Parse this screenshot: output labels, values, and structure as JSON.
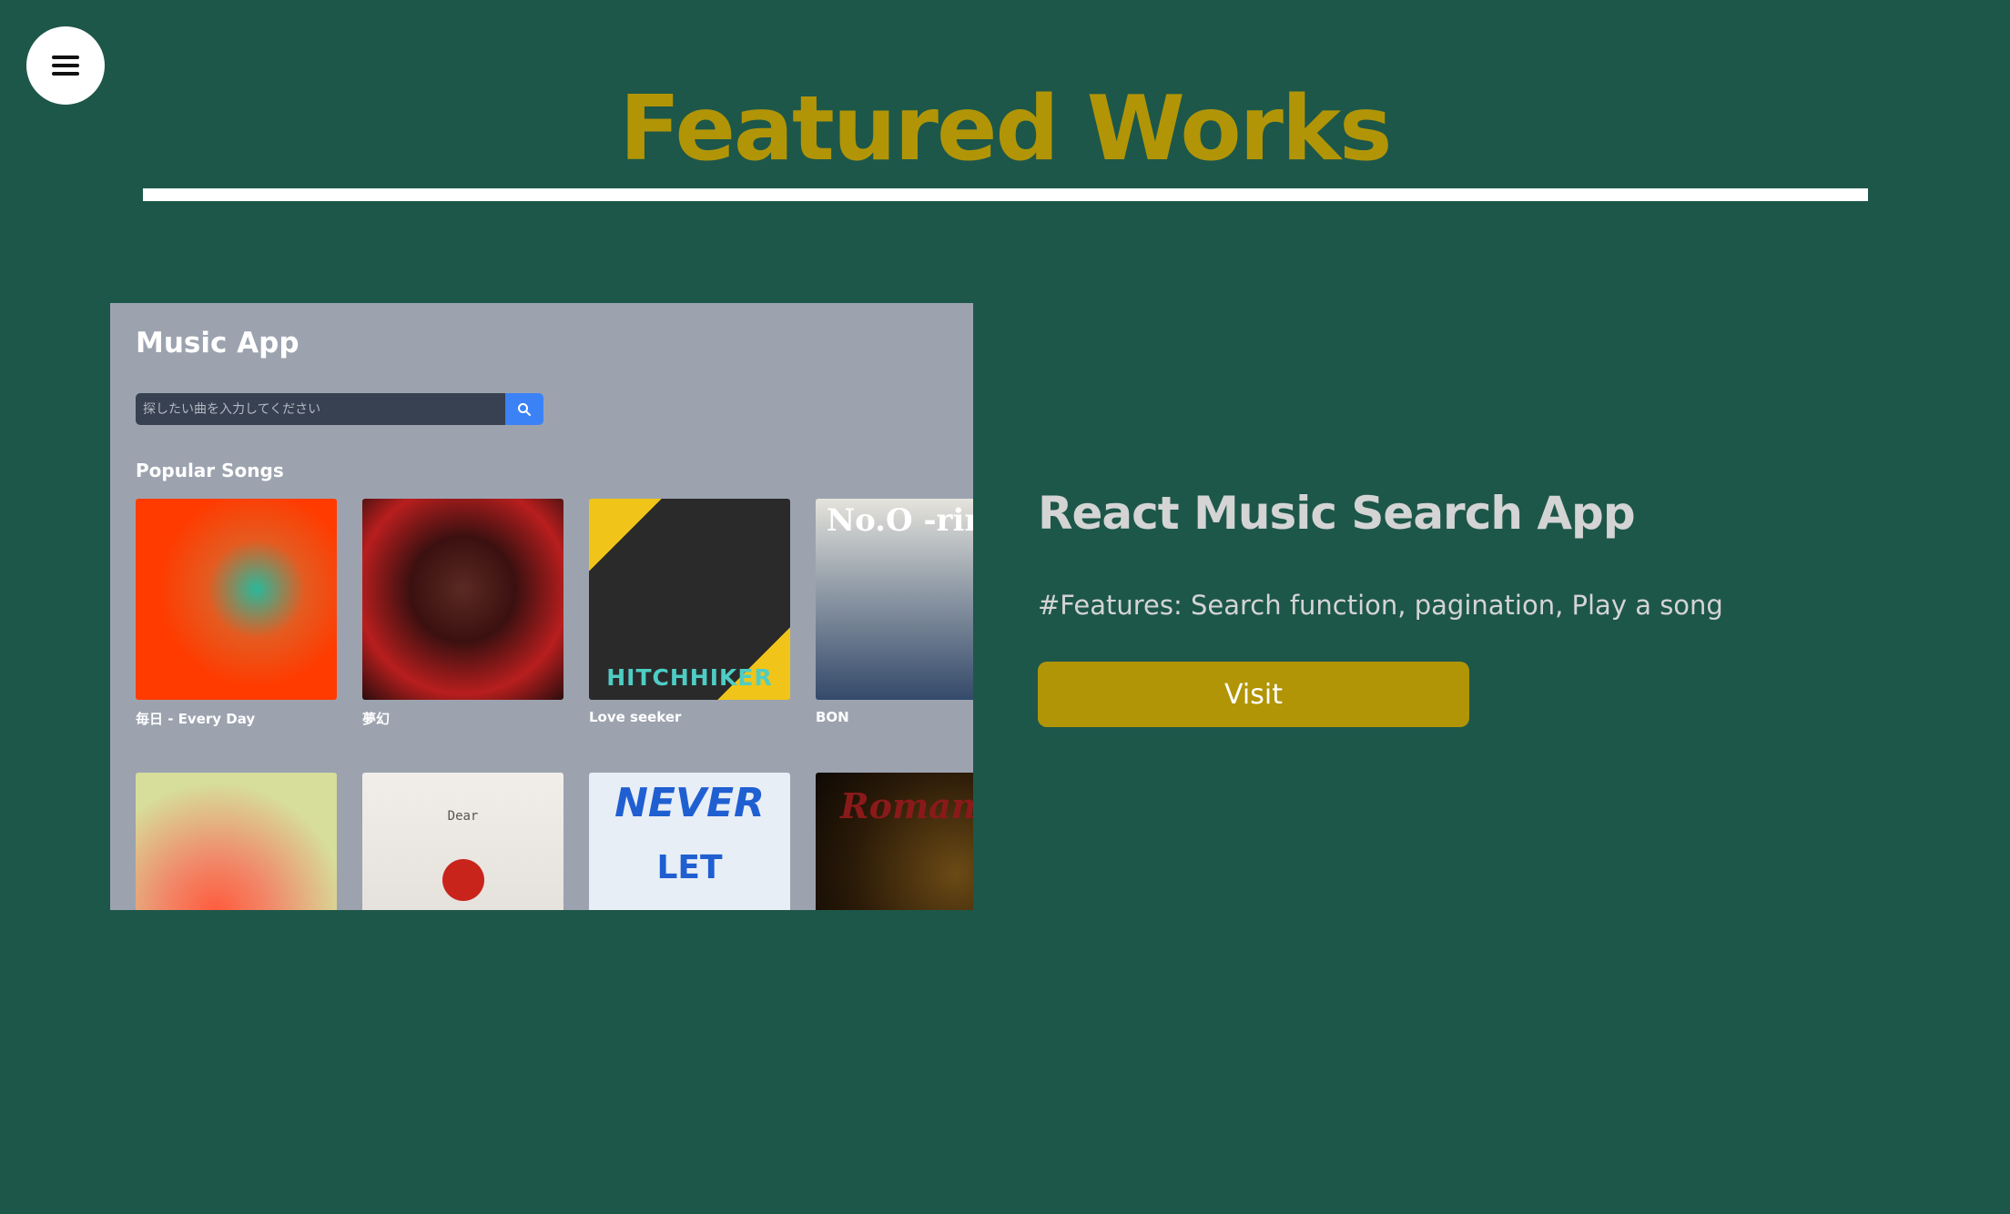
{
  "header": {
    "menu_icon": "hamburger-menu-icon",
    "title": "Featured Works"
  },
  "preview": {
    "app_title": "Music App",
    "search": {
      "placeholder": "探したい曲を入力してください",
      "button_icon": "search-icon"
    },
    "section_title": "Popular Songs",
    "songs": [
      {
        "title": "毎日 - Every Day"
      },
      {
        "title": "夢幻"
      },
      {
        "title": "Love seeker",
        "cover_text": "HITCHHIKER"
      },
      {
        "title": "BON",
        "cover_text": "No.O -rin"
      },
      {
        "title": ""
      },
      {
        "title": "",
        "cover_text": "Dear"
      },
      {
        "title": "",
        "cover_text": "NEVER",
        "cover_text_2": "LET"
      },
      {
        "title": "",
        "cover_text": "Romant"
      }
    ]
  },
  "project": {
    "title": "React Music Search App",
    "features": "#Features: Search function, pagination, Play a song",
    "visit_label": "Visit"
  },
  "colors": {
    "background": "#1d5749",
    "accent": "#b19507",
    "preview_bg": "#9ca3af",
    "search_button": "#3b82f6"
  }
}
